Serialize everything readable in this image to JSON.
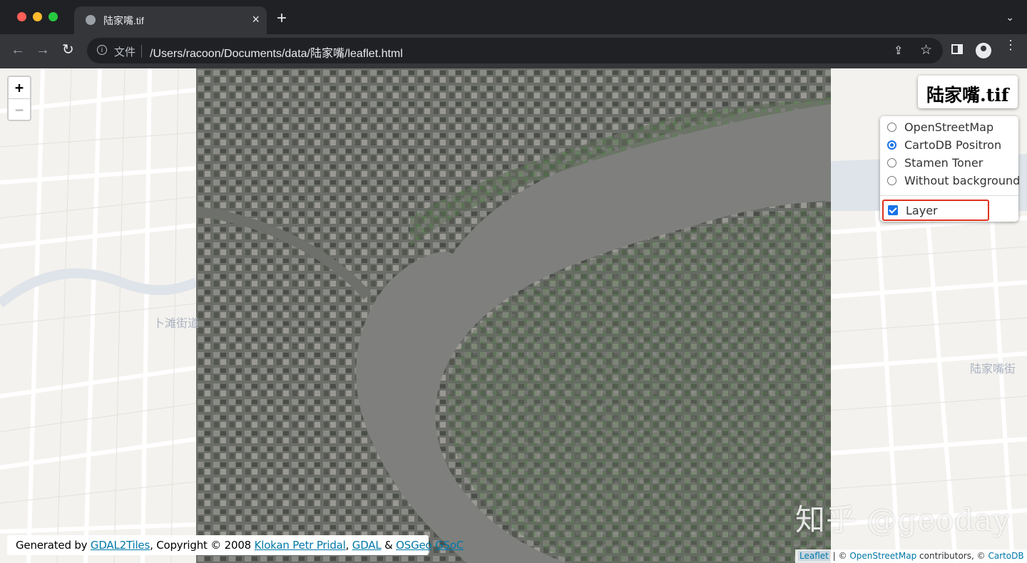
{
  "browser": {
    "tab_title": "陆家嘴.tif",
    "tab_close": "×",
    "new_tab": "+",
    "tabs_menu": "⌄",
    "nav_back": "←",
    "nav_forward": "→",
    "nav_reload": "↻",
    "omnibox_scheme_label": "文件",
    "omnibox_url": "/Users/racoon/Documents/data/陆家嘴/leaflet.html",
    "share_icon": "⇪",
    "star_icon": "☆",
    "menu_icon": "⋮"
  },
  "map": {
    "zoom_in": "+",
    "zoom_out": "−",
    "title": "陆家嘴.tif",
    "base_layers": [
      {
        "label": "OpenStreetMap",
        "checked": false
      },
      {
        "label": "CartoDB Positron",
        "checked": true
      },
      {
        "label": "Stamen Toner",
        "checked": false
      },
      {
        "label": "Without background",
        "checked": false
      }
    ],
    "overlay_label": "Layer",
    "overlay_checked": true,
    "generated": {
      "prefix": "Generated by ",
      "gdal2tiles": "GDAL2Tiles",
      "copyright": ", Copyright © 2008 ",
      "author": "Klokan Petr Pridal",
      "comma": ", ",
      "gdal": "GDAL",
      "amp": " & ",
      "osgeo": "OSGeo",
      "space": " ",
      "gsoc": "GSoC"
    },
    "attribution": {
      "leaflet": "Leaflet",
      "sep": " | © ",
      "osm": "OpenStreetMap",
      "contrib": " contributors, © ",
      "carto": "CartoDB"
    },
    "place_labels": {
      "left": "卜滩街道",
      "right": "陆家嘴街"
    }
  },
  "watermark": "知乎 @geoday"
}
